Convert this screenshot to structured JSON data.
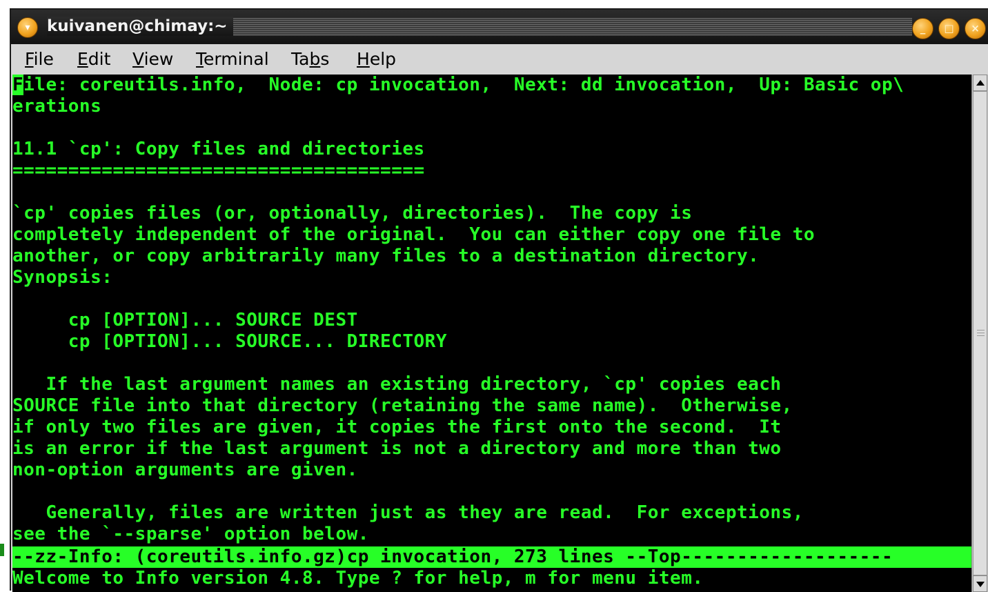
{
  "window": {
    "title": "kuivanen@chimay:~",
    "title_icon": "terminal-app-icon",
    "buttons": {
      "minimize_icon": "minimize-icon",
      "maximize_icon": "maximize-icon",
      "close_icon": "close-icon"
    }
  },
  "menu": {
    "items": [
      {
        "pre": "",
        "u": "F",
        "post": "ile"
      },
      {
        "pre": "",
        "u": "E",
        "post": "dit"
      },
      {
        "pre": "",
        "u": "V",
        "post": "iew"
      },
      {
        "pre": "",
        "u": "T",
        "post": "erminal"
      },
      {
        "pre": "Ta",
        "u": "b",
        "post": "s"
      },
      {
        "pre": "",
        "u": "H",
        "post": "elp"
      }
    ]
  },
  "terminal": {
    "cursor_char": "F",
    "lines": [
      "ile: coreutils.info,  Node: cp invocation,  Next: dd invocation,  Up: Basic op\\",
      "erations",
      "",
      "11.1 `cp': Copy files and directories",
      "=====================================",
      "",
      "`cp' copies files (or, optionally, directories).  The copy is",
      "completely independent of the original.  You can either copy one file to",
      "another, or copy arbitrarily many files to a destination directory.",
      "Synopsis:",
      "",
      "     cp [OPTION]... SOURCE DEST",
      "     cp [OPTION]... SOURCE... DIRECTORY",
      "",
      "   If the last argument names an existing directory, `cp' copies each",
      "SOURCE file into that directory (retaining the same name).  Otherwise,",
      "if only two files are given, it copies the first onto the second.  It",
      "is an error if the last argument is not a directory and more than two",
      "non-option arguments are given.",
      "",
      "   Generally, files are written just as they are read.  For exceptions,",
      "see the `--sparse' option below."
    ],
    "mode_line": "--zz-Info: (coreutils.info.gz)cp invocation, 273 lines --Top-------------------",
    "echo_line": "Welcome to Info version 4.8. Type ? for help, m for menu item.",
    "colors": {
      "foreground": "#27ff27",
      "background": "#000000"
    }
  },
  "scrollbar": {
    "up_icon": "scroll-up-arrow-icon",
    "down_icon": "scroll-down-arrow-icon",
    "position": 0
  }
}
